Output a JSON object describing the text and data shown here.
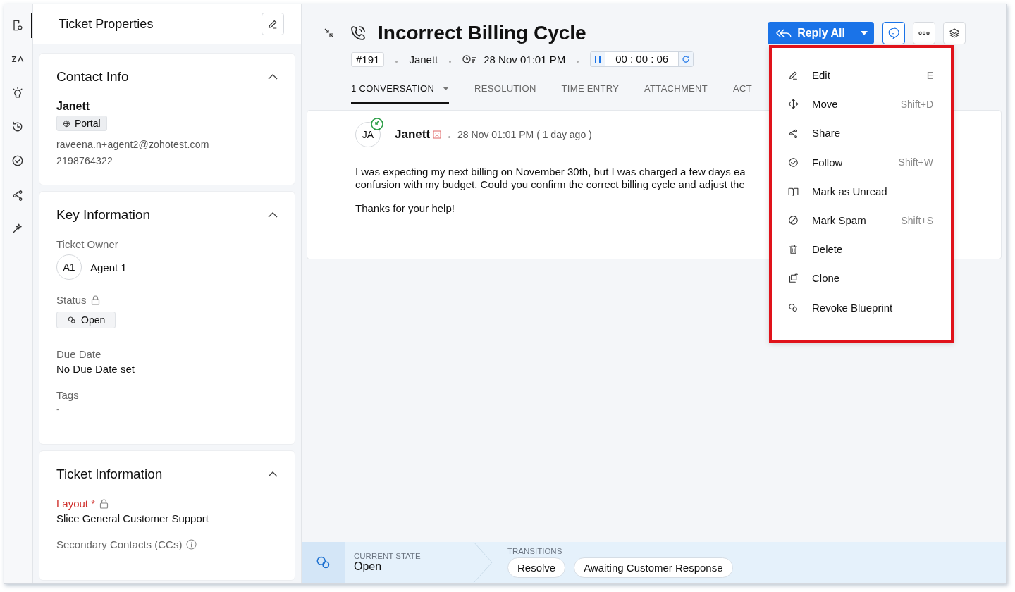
{
  "rail": [
    {
      "selected": true
    },
    {
      "selected": false
    },
    {
      "selected": false
    },
    {
      "selected": false
    },
    {
      "selected": false
    },
    {
      "selected": false
    },
    {
      "selected": false
    }
  ],
  "properties": {
    "title": "Ticket Properties"
  },
  "contact": {
    "title": "Contact Info",
    "name": "Janett",
    "channel": "Portal",
    "email": "raveena.n+agent2@zohotest.com",
    "phone": "2198764322"
  },
  "key_info": {
    "title": "Key Information",
    "fields": [
      {
        "kind": "owner",
        "label": "Ticket Owner",
        "initials": "A1",
        "value": "Agent 1"
      },
      {
        "kind": "status",
        "label": "Status",
        "locked": true,
        "value": "Open"
      },
      {
        "kind": "text",
        "label": "Due Date",
        "value": "No Due Date set"
      },
      {
        "kind": "empty",
        "label": "Tags",
        "value": "-"
      }
    ]
  },
  "ticket_info": {
    "title": "Ticket Information",
    "fields": [
      {
        "kind": "text",
        "label": "Layout *",
        "required": true,
        "locked": true,
        "value": "Slice General Customer Support"
      },
      {
        "kind": "info",
        "label": "Secondary Contacts (CCs)"
      }
    ]
  },
  "header": {
    "title": "Incorrect Billing Cycle",
    "id": "#191",
    "contact": "Janett",
    "created": "28 Nov 01:01 PM",
    "timer": "00 : 00 : 06",
    "reply": "Reply All"
  },
  "tabs": [
    {
      "label": "1 CONVERSATION",
      "selected": true,
      "dropdown": true
    },
    {
      "label": "RESOLUTION",
      "selected": false
    },
    {
      "label": "TIME ENTRY",
      "selected": false
    },
    {
      "label": "ATTACHMENT",
      "selected": false
    },
    {
      "label": "ACT",
      "selected": false
    }
  ],
  "message": {
    "initials": "JA",
    "author": "Janett",
    "time": "28 Nov 01:01 PM ( 1 day ago )",
    "paragraphs": [
      [
        "I was expecting my next billing on November 30th, but I was charged a few days ea",
        "confusion with my budget. Could you confirm the correct billing cycle and adjust the"
      ],
      [
        "Thanks for your help!"
      ]
    ]
  },
  "menu": [
    {
      "label": "Edit",
      "shortcut": "E"
    },
    {
      "label": "Move",
      "shortcut": "Shift+D"
    },
    {
      "label": "Share"
    },
    {
      "label": "Follow",
      "shortcut": "Shift+W"
    },
    {
      "label": "Mark as Unread"
    },
    {
      "label": "Mark Spam",
      "shortcut": "Shift+S"
    },
    {
      "label": "Delete"
    },
    {
      "label": "Clone"
    },
    {
      "label": "Revoke Blueprint"
    }
  ],
  "blueprint": {
    "state_label": "CURRENT STATE",
    "state": "Open",
    "transitions_label": "TRANSITIONS",
    "transitions": [
      "Resolve",
      "Awaiting Customer Response"
    ]
  }
}
